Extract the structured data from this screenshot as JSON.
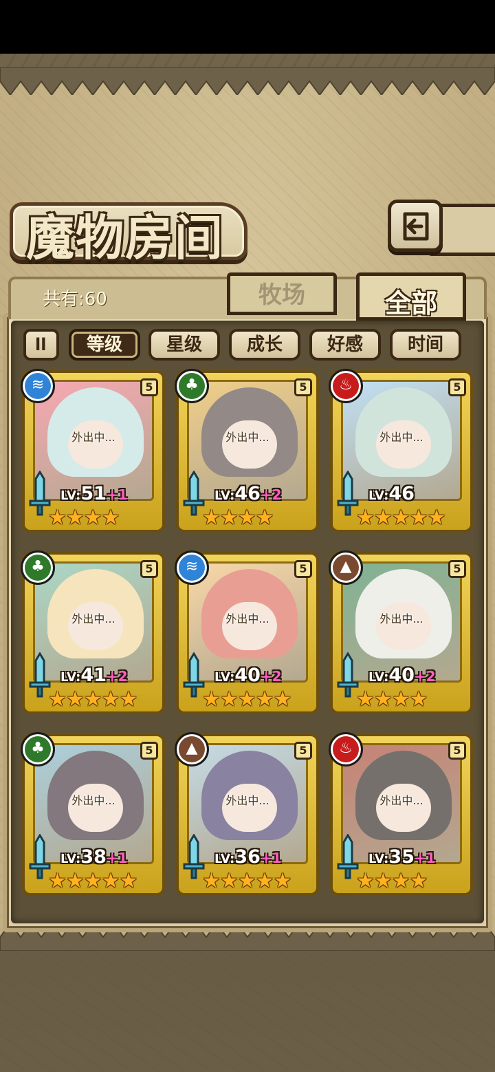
{
  "screen": {
    "title": "魔物房间",
    "count_label": "共有:60",
    "back_icon": "return-arrow-icon"
  },
  "tabs": [
    {
      "label": "牧场",
      "active": false
    },
    {
      "label": "全部",
      "active": true
    }
  ],
  "sort": {
    "toggle_icon": "sort-order-icon",
    "toggle_glyph": "ll",
    "options": [
      {
        "label": "等级",
        "active": true
      },
      {
        "label": "星级",
        "active": false
      },
      {
        "label": "成长",
        "active": false
      },
      {
        "label": "好感",
        "active": false
      },
      {
        "label": "时间",
        "active": false
      }
    ]
  },
  "element_colors": {
    "water": "#2f84d8",
    "wood": "#2e7a2a",
    "fire": "#c81c1c",
    "earth": "#7a4a30"
  },
  "monsters": [
    {
      "element": "water",
      "element_glyph": "≋",
      "rank": "5",
      "status": "外出中...",
      "level": "51",
      "bonus": "+1",
      "stars": 4,
      "hair": "#bfe0de",
      "accent": "#f47a8a"
    },
    {
      "element": "wood",
      "element_glyph": "♣",
      "rank": "5",
      "status": "外出中...",
      "level": "46",
      "bonus": "+2",
      "stars": 4,
      "hair": "#5a4b46",
      "accent": "#e9b54a"
    },
    {
      "element": "fire",
      "element_glyph": "♨",
      "rank": "5",
      "status": "外出中...",
      "level": "46",
      "bonus": "",
      "stars": 5,
      "hair": "#b7d6c9",
      "accent": "#9fd0ef"
    },
    {
      "element": "wood",
      "element_glyph": "♣",
      "rank": "5",
      "status": "外出中...",
      "level": "41",
      "bonus": "+2",
      "stars": 5,
      "hair": "#f2d69a",
      "accent": "#7ec2a8"
    },
    {
      "element": "water",
      "element_glyph": "≋",
      "rank": "5",
      "status": "外出中...",
      "level": "40",
      "bonus": "+2",
      "stars": 5,
      "hair": "#de6b5b",
      "accent": "#f5c27a"
    },
    {
      "element": "earth",
      "element_glyph": "▲",
      "rank": "5",
      "status": "外出中...",
      "level": "40",
      "bonus": "+2",
      "stars": 4,
      "hair": "#e7e6de",
      "accent": "#3c8a5a"
    },
    {
      "element": "wood",
      "element_glyph": "♣",
      "rank": "5",
      "status": "外出中...",
      "level": "38",
      "bonus": "+1",
      "stars": 5,
      "hair": "#3f3138",
      "accent": "#7fb6c9"
    },
    {
      "element": "earth",
      "element_glyph": "▲",
      "rank": "5",
      "status": "外出中...",
      "level": "36",
      "bonus": "+1",
      "stars": 5,
      "hair": "#4a3f6e",
      "accent": "#a6c7d8"
    },
    {
      "element": "fire",
      "element_glyph": "♨",
      "rank": "5",
      "status": "外出中...",
      "level": "35",
      "bonus": "+1",
      "stars": 4,
      "hair": "#2d241e",
      "accent": "#a8402c"
    }
  ]
}
